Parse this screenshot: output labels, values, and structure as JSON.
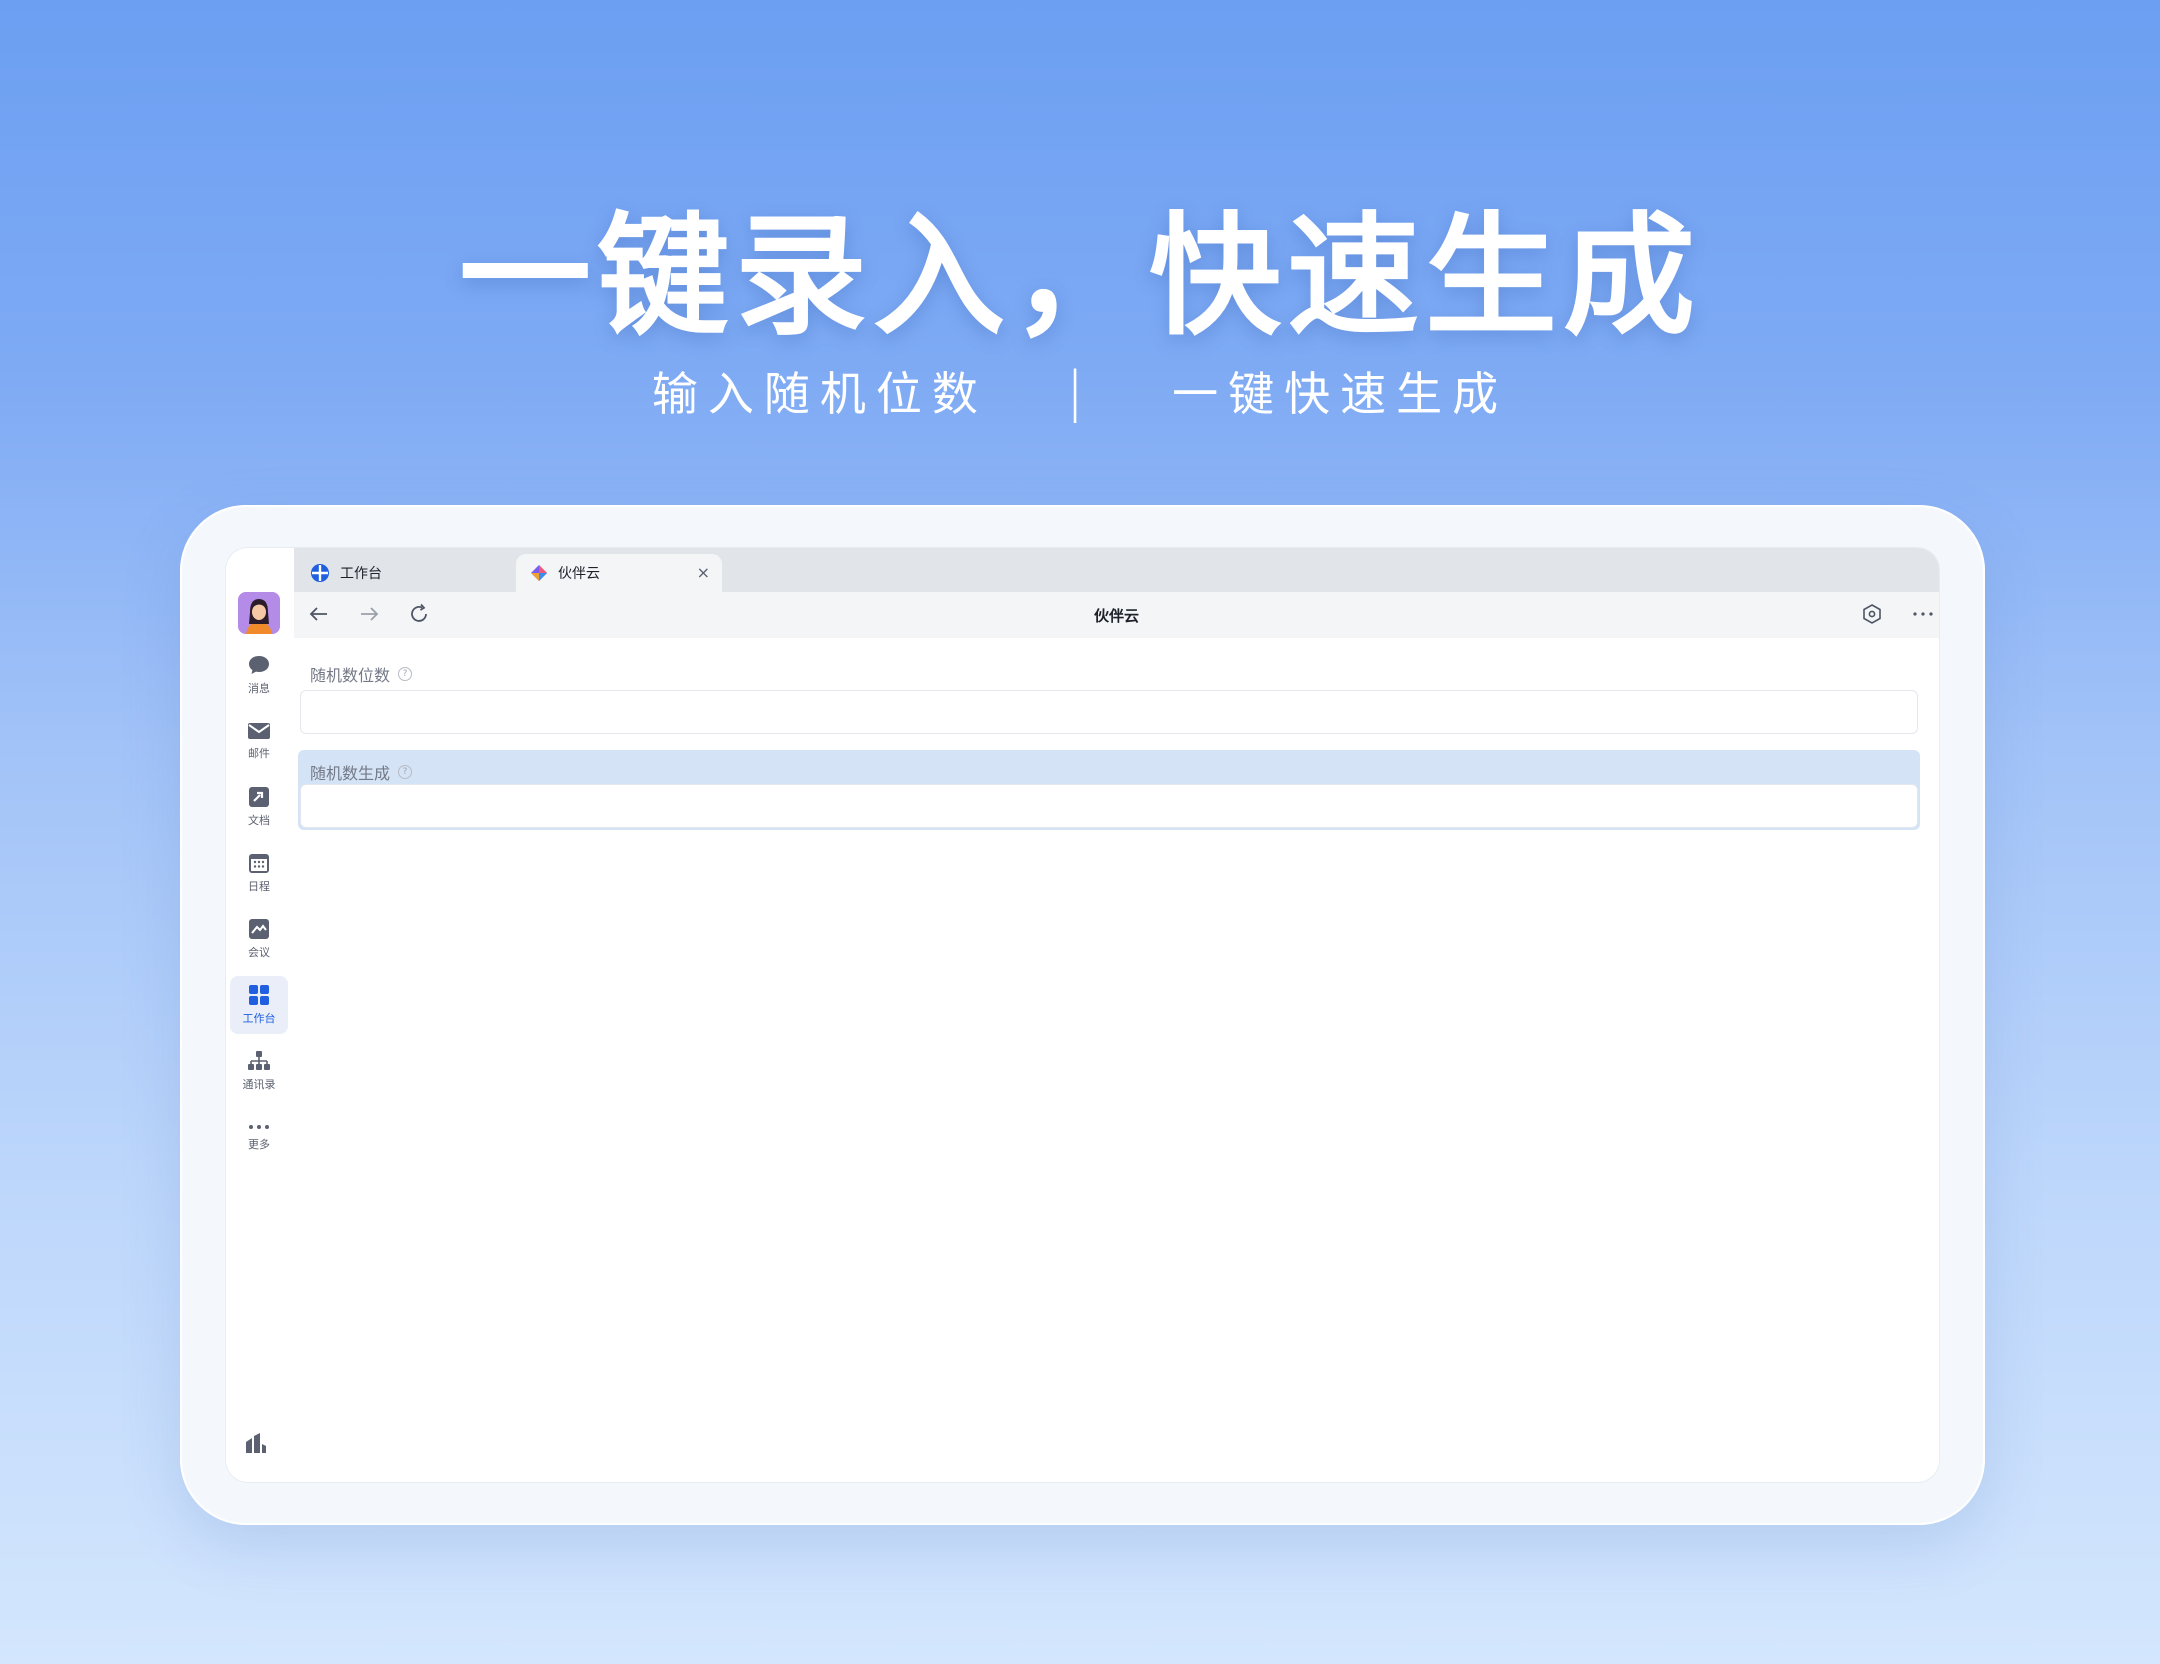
{
  "banner": {
    "headline": "一键录入，快速生成",
    "sub_left": "输入随机位数",
    "separator": "|",
    "sub_right": "一键快速生成"
  },
  "sidebar": {
    "items": [
      {
        "label": "消息",
        "icon": "chat-bubble-icon"
      },
      {
        "label": "邮件",
        "icon": "mail-icon"
      },
      {
        "label": "文档",
        "icon": "document-icon"
      },
      {
        "label": "日程",
        "icon": "calendar-icon"
      },
      {
        "label": "会议",
        "icon": "meeting-icon"
      },
      {
        "label": "工作台",
        "icon": "workbench-grid-icon",
        "active": true
      },
      {
        "label": "通讯录",
        "icon": "org-chart-icon"
      },
      {
        "label": "更多",
        "icon": "more-dots-icon"
      }
    ],
    "accent": "#1f5fe0"
  },
  "browser": {
    "tabs": [
      {
        "label": "工作台",
        "icon": "workbench-tab-icon"
      },
      {
        "label": "伙伴云",
        "icon": "huoban-logo-icon",
        "close": "×",
        "active": true
      }
    ],
    "title": "伙伴云"
  },
  "form": {
    "field1": {
      "label": "随机数位数",
      "help": "?",
      "value": ""
    },
    "field2": {
      "label": "随机数生成",
      "help": "?",
      "value": ""
    }
  }
}
